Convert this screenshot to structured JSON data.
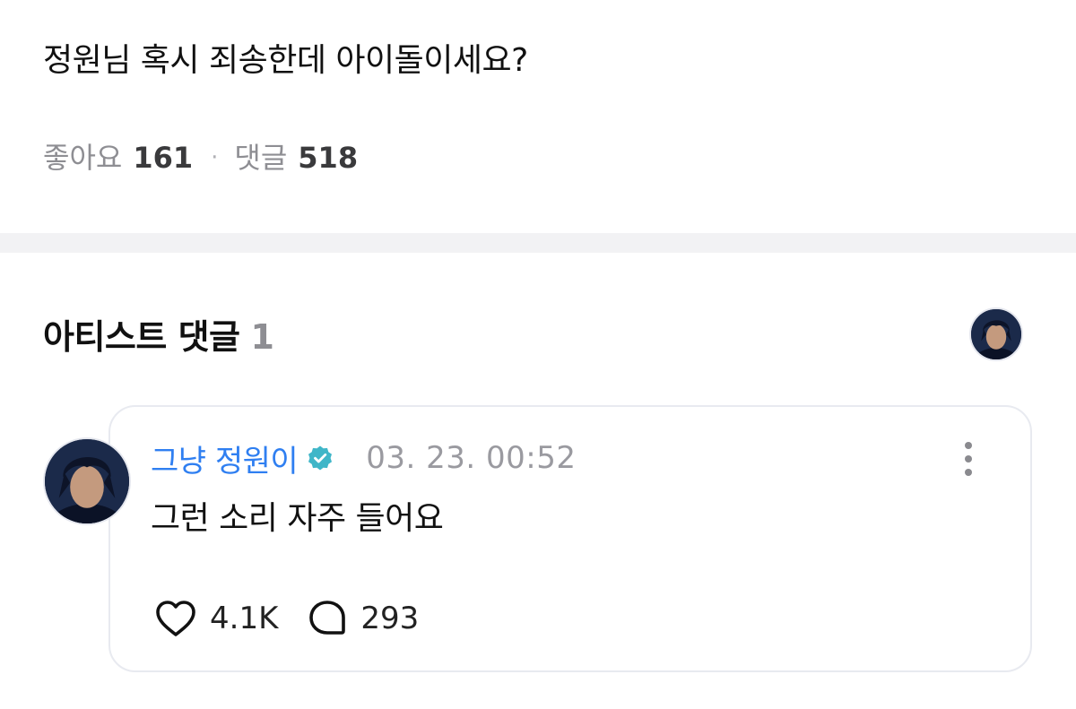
{
  "post": {
    "body": "정원님 혹시 죄송한데 아이돌이세요?",
    "likes_label": "좋아요",
    "likes_count": "161",
    "separator": "·",
    "comments_label": "댓글",
    "comments_count": "518"
  },
  "artist_section": {
    "title": "아티스트 댓글",
    "count": "1"
  },
  "comment": {
    "author": "그냥 정원이",
    "verified_icon": "verified-badge-icon",
    "timestamp": "03. 23. 00:52",
    "text": "그런 소리 자주 들어요",
    "like_count": "4.1K",
    "reply_count": "293"
  },
  "colors": {
    "author_blue": "#2f7ff1",
    "verified_teal": "#3fb6c8",
    "muted_gray": "#8e8e93",
    "divider_gray": "#f2f2f4",
    "card_border": "#e8eaf0"
  }
}
